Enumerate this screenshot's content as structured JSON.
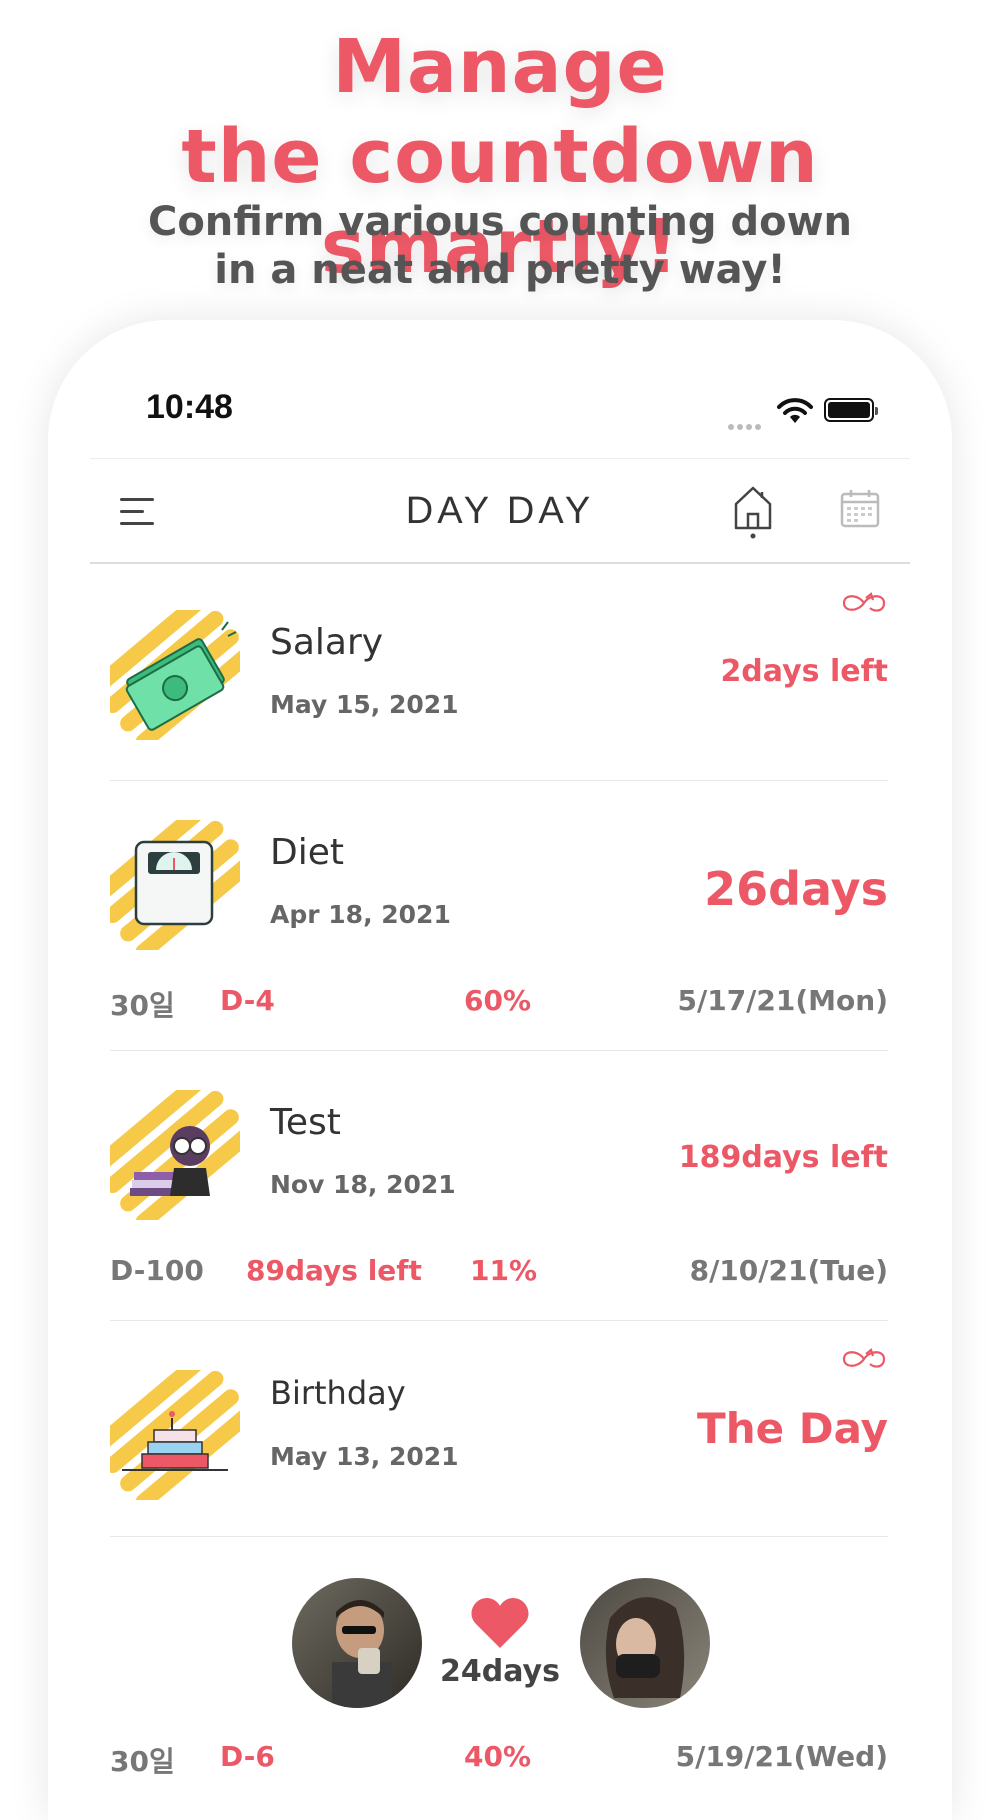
{
  "promo": {
    "headline_line1": "Manage",
    "headline_line2": "the countdown smartly!",
    "subline_line1": "Confirm various counting down",
    "subline_line2": "in a neat and pretty way!"
  },
  "status_bar": {
    "time": "10:48"
  },
  "navbar": {
    "app_title": "DAY DAY"
  },
  "items": [
    {
      "title": "Salary",
      "date": "May 15, 2021",
      "remaining": "2days left",
      "icon": "money-icon",
      "repeat": true
    },
    {
      "title": "Diet",
      "date": "Apr 18, 2021",
      "remaining": "26days",
      "icon": "scale-icon",
      "stats": {
        "goal": "30일",
        "dday": "D-4",
        "percent": "60%",
        "end_date": "5/17/21(Mon)"
      }
    },
    {
      "title": "Test",
      "date": "Nov 18, 2021",
      "remaining": "189days left",
      "icon": "study-icon",
      "stats": {
        "goal": "D-100",
        "dday": "89days left",
        "percent": "11%",
        "end_date": "8/10/21(Tue)"
      }
    },
    {
      "title": "Birthday",
      "date": "May 13, 2021",
      "remaining": "The Day",
      "icon": "cake-icon",
      "repeat": true
    }
  ],
  "couple": {
    "count": "24days",
    "stats": {
      "goal": "30일",
      "dday": "D-6",
      "percent": "40%",
      "end_date": "5/19/21(Wed)"
    }
  },
  "colors": {
    "accent": "#ec5866",
    "icon_bg": "#f7c948"
  }
}
